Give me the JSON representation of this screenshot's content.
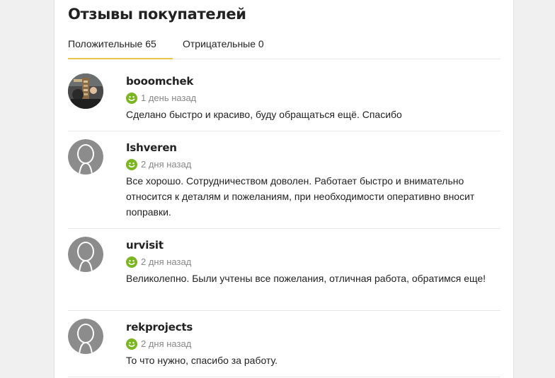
{
  "header": {
    "title": "Отзывы покупателей"
  },
  "tabs": [
    {
      "label": "Положительные 65",
      "active": true
    },
    {
      "label": "Отрицательные 0",
      "active": false
    }
  ],
  "colors": {
    "accent": "#e8c44a",
    "positive": "#7ab61f"
  },
  "reviews": [
    {
      "user": "booomchek",
      "time": "1 день назад",
      "text": "Сделано быстро и красиво, буду обращаться ещё. Спасибо",
      "avatar": "photo"
    },
    {
      "user": "Ishveren",
      "time": "2 дня назад",
      "text": "Все хорошо. Сотрудничеством доволен. Работает быстро и внимательно относится к деталям и пожеланиям, при необходимости оперативно вносит поправки.",
      "avatar": "default"
    },
    {
      "user": "urvisit",
      "time": "2 дня назад",
      "text": "Великолепно. Были учтены все пожелания, отличная работа, обратимся еще!",
      "avatar": "default"
    },
    {
      "user": "rekprojects",
      "time": "2 дня назад",
      "text": "То что нужно, спасибо за работу.",
      "avatar": "default"
    }
  ]
}
